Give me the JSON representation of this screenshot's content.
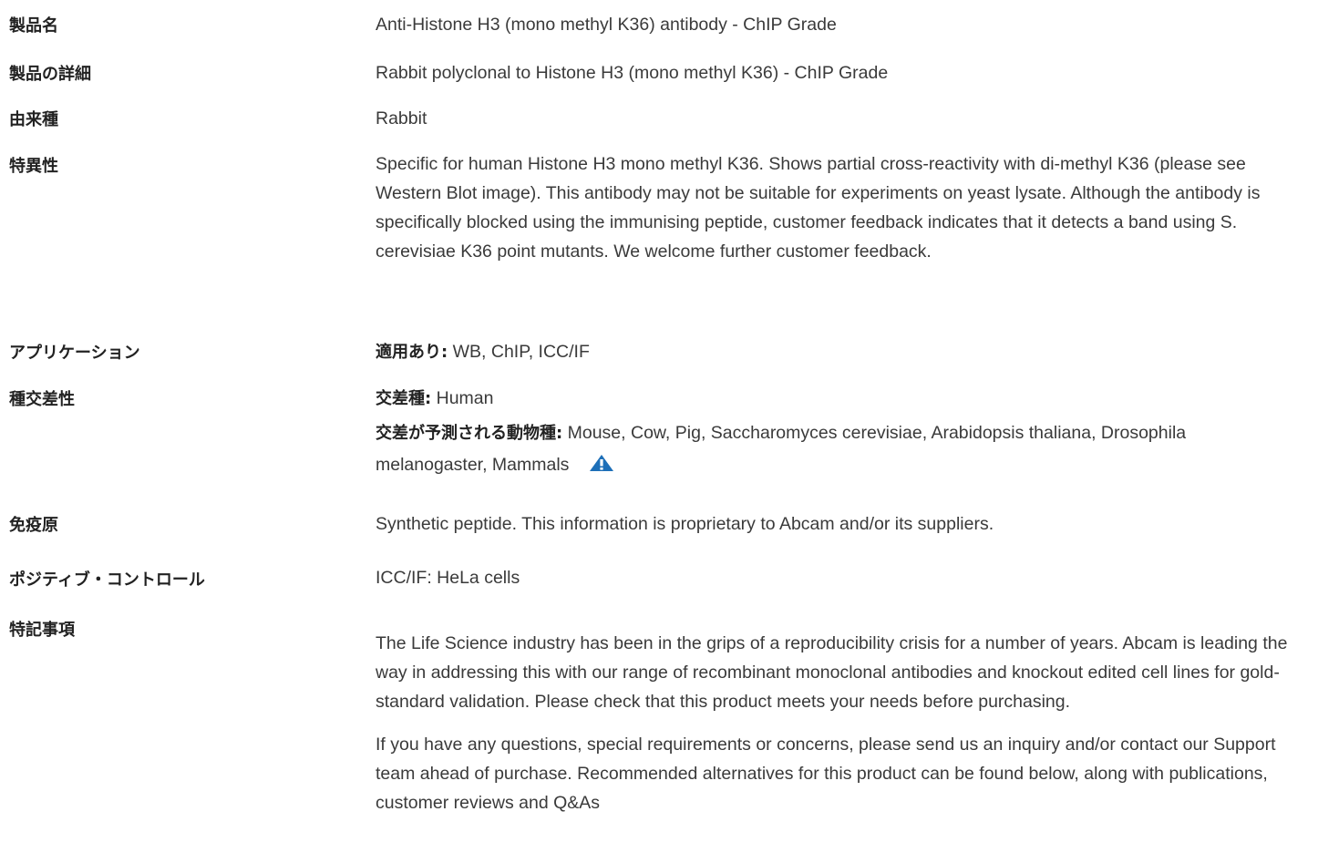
{
  "rows": {
    "product_name": {
      "label": "製品名",
      "value": "Anti-Histone H3 (mono methyl K36) antibody - ChIP Grade"
    },
    "product_detail": {
      "label": "製品の詳細",
      "value": "Rabbit polyclonal to Histone H3 (mono methyl K36) - ChIP Grade"
    },
    "host": {
      "label": "由来種",
      "value": "Rabbit"
    },
    "specificity": {
      "label": "特異性",
      "value": "Specific for human Histone H3 mono methyl K36. Shows partial cross-reactivity with di-methyl K36 (please see Western Blot image). This antibody may not be suitable for experiments on yeast lysate. Although the antibody is specifically blocked using the immunising peptide, customer feedback indicates that it detects a band using S. cerevisiae K36 point mutants. We welcome further customer feedback."
    },
    "application": {
      "label": "アプリケーション",
      "key": "適用あり:",
      "value": " WB, ChIP, ICC/IF"
    },
    "reactivity": {
      "label": "種交差性",
      "reacts_key": "交差種:",
      "reacts_value": " Human",
      "predicted_key": "交差が予測される動物種:",
      "predicted_value": " Mouse, Cow, Pig, Saccharomyces cerevisiae, Arabidopsis thaliana, Drosophila melanogaster, Mammals",
      "warning_icon": "warning-triangle-icon"
    },
    "immunogen": {
      "label": "免疫原",
      "value": "Synthetic peptide. This information is proprietary to Abcam and/or its suppliers."
    },
    "positive_control": {
      "label": "ポジティブ・コントロール",
      "value": "ICC/IF: HeLa cells"
    },
    "general_notes": {
      "label": "特記事項",
      "para1": "The Life Science industry has been in the grips of a reproducibility crisis for a number of years. Abcam is leading the way in addressing this with our range of recombinant monoclonal antibodies and knockout edited cell lines for gold-standard validation. Please check that this product meets your needs before purchasing.",
      "para2": "If you have any questions, special requirements or concerns, please send us an inquiry and/or contact our Support team ahead of purchase. Recommended alternatives for this product can be found below, along with publications, customer reviews and Q&As"
    }
  },
  "colors": {
    "text": "#3a3a3a",
    "label": "#222222",
    "warning_icon": "#1d6fb8"
  }
}
